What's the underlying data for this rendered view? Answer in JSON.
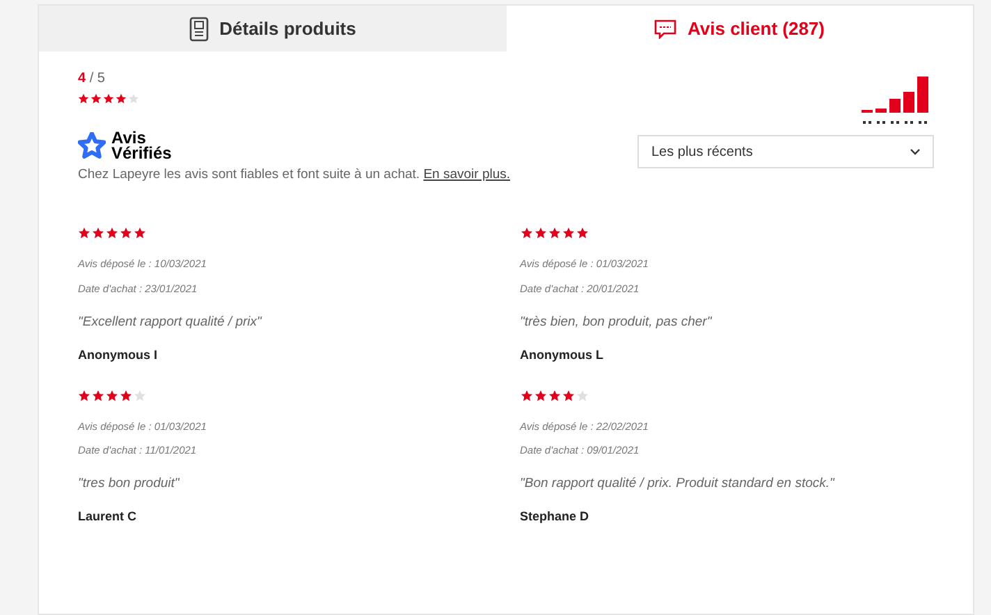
{
  "tabs": [
    {
      "label": "Détails produits",
      "selected": false
    },
    {
      "label": "Avis client (287)",
      "selected": true
    }
  ],
  "summary": {
    "score": "4",
    "total": "/ 5",
    "stars": 4
  },
  "verified": {
    "brand": "Avis Vérifiés",
    "text": "Chez Lapeyre les avis sont fiables et font suite à un achat.",
    "link": "En savoir plus."
  },
  "sort": {
    "value": "Les plus récents"
  },
  "reviews": [
    {
      "stars": 5,
      "posted": "Avis déposé le : 10/03/2021",
      "purchased": "Date d'achat : 23/01/2021",
      "comment": "\"Excellent rapport qualité / prix\"",
      "author": "Anonymous I"
    },
    {
      "stars": 5,
      "posted": "Avis déposé le : 01/03/2021",
      "purchased": "Date d'achat : 20/01/2021",
      "comment": "\"très bien, bon produit, pas cher\"",
      "author": "Anonymous L"
    },
    {
      "stars": 4,
      "posted": "Avis déposé le : 01/03/2021",
      "purchased": "Date d'achat : 11/01/2021",
      "comment": "\"tres bon produit\"",
      "author": "Laurent C"
    },
    {
      "stars": 4,
      "posted": "Avis déposé le : 22/02/2021",
      "purchased": "Date d'achat : 09/01/2021",
      "comment": "\"Bon rapport qualité / prix. Produit standard en stock.\"",
      "author": "Stephane D"
    }
  ]
}
